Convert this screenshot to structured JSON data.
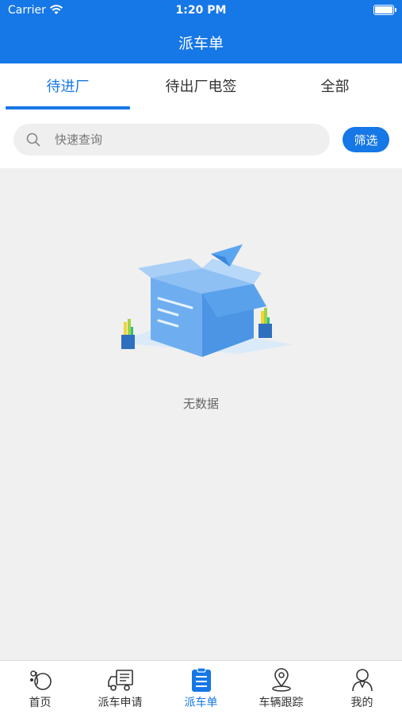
{
  "status_bar": {
    "carrier": "Carrier",
    "time": "1:20 PM"
  },
  "header": {
    "title": "派车单"
  },
  "tabs": [
    {
      "label": "待进厂",
      "active": true
    },
    {
      "label": "待出厂电签",
      "active": false
    },
    {
      "label": "全部",
      "active": false
    }
  ],
  "search": {
    "placeholder": "快速查询",
    "value": "",
    "filter_label": "筛选"
  },
  "empty_state": {
    "message": "无数据",
    "icon": "empty-box-illustration"
  },
  "bottom_nav": [
    {
      "label": "首页",
      "icon": "home-icon",
      "active": false
    },
    {
      "label": "派车申请",
      "icon": "truck-icon",
      "active": false
    },
    {
      "label": "派车单",
      "icon": "document-list-icon",
      "active": true
    },
    {
      "label": "车辆跟踪",
      "icon": "location-pin-icon",
      "active": false
    },
    {
      "label": "我的",
      "icon": "user-icon",
      "active": false
    }
  ],
  "colors": {
    "primary": "#1677e6",
    "background": "#f0f0f0"
  }
}
